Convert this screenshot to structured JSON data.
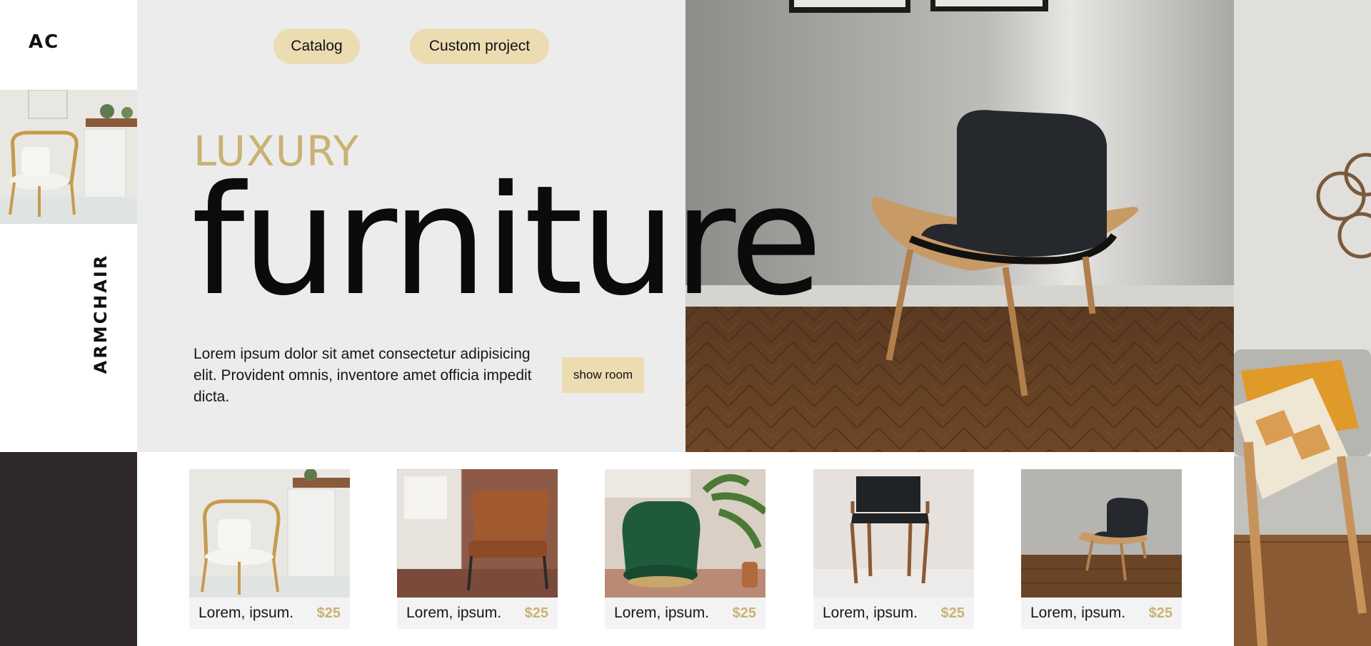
{
  "sidebar": {
    "logo": "AC",
    "vertical_label": "ARMCHAIR"
  },
  "nav": {
    "catalog_label": "Catalog",
    "custom_project_label": "Custom project"
  },
  "hero": {
    "eyebrow": "LUXURY",
    "headline": "furniture",
    "description": "Lorem ipsum dolor sit amet consectetur adipisicing elit. Provident omnis, inventore amet officia impedit dicta.",
    "show_room_label": "show room"
  },
  "products": [
    {
      "name": "Lorem, ipsum.",
      "price": "$25"
    },
    {
      "name": "Lorem, ipsum.",
      "price": "$25"
    },
    {
      "name": "Lorem, ipsum.",
      "price": "$25"
    },
    {
      "name": "Lorem, ipsum.",
      "price": "$25"
    },
    {
      "name": "Lorem, ipsum.",
      "price": "$25"
    }
  ],
  "colors": {
    "accent_gold": "#c9b273",
    "button_beige": "#ecdcb2",
    "panel_grey": "#ececec",
    "dark_block": "#2e2829"
  }
}
